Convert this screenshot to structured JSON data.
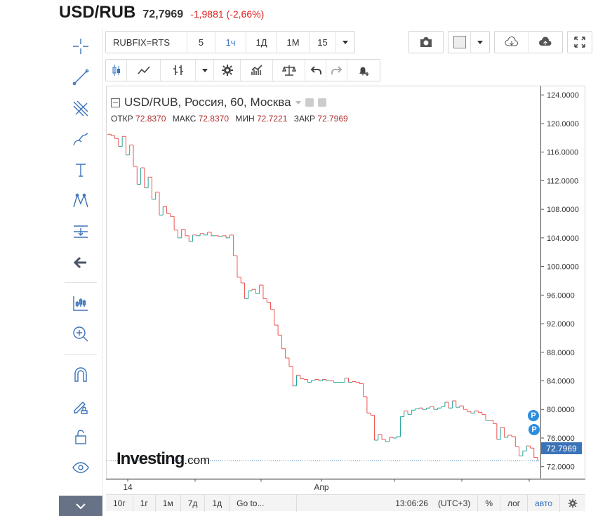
{
  "header": {
    "symbol": "USD/RUB",
    "price": "72,7969",
    "change": "-1,9881 (-2,66%)"
  },
  "toolbar": {
    "symbol_input": "RUBFIX=RTS",
    "intervals": [
      "5",
      "1ч",
      "1Д",
      "1М",
      "15"
    ],
    "active_interval": "1ч"
  },
  "legend": {
    "title": "USD/RUB, Россия, 60, Москва",
    "open_label": "ОТКР",
    "open": "72.8370",
    "high_label": "МАКС",
    "high": "72.8370",
    "low_label": "МИН",
    "low": "72.7221",
    "close_label": "ЗАКР",
    "close": "72.7969"
  },
  "logo": {
    "brand": "Investing",
    "suffix": ".com"
  },
  "last_price": "72.7969",
  "bottom": {
    "ranges": [
      "10г",
      "1г",
      "1м",
      "7д",
      "1д"
    ],
    "goto": "Go to...",
    "time": "13:06:26",
    "tz": "(UTC+3)",
    "percent": "%",
    "log": "лог",
    "auto": "авто"
  },
  "colors": {
    "up": "#26a69a",
    "down": "#ef5350",
    "accent": "#3b73b9",
    "change": "#e0201b"
  },
  "chart_data": {
    "type": "line",
    "xlabel": "",
    "ylabel": "",
    "x_ticks": [
      "14",
      "Апр"
    ],
    "y_ticks": [
      "72.0000",
      "76.0000",
      "80.0000",
      "84.0000",
      "88.0000",
      "92.0000",
      "96.0000",
      "100.0000",
      "104.0000",
      "108.0000",
      "112.0000",
      "116.0000",
      "120.0000",
      "124.0000"
    ],
    "ylim": [
      70.4,
      125.2
    ],
    "series": [
      {
        "values": [
          118.5,
          118.3,
          117.9,
          116.8,
          118.2,
          115.6,
          117.0,
          114.0,
          111.5,
          113.8,
          111.0,
          112.5,
          109.4,
          110.4,
          107.2,
          108.4,
          107.4,
          107.0,
          105.1,
          104.0,
          105.2,
          104.3,
          103.5,
          104.4,
          104.3,
          104.6,
          104.4,
          104.8,
          104.3,
          104.3,
          104.2,
          104.3,
          104.0,
          104.4,
          101.5,
          98.5,
          97.7,
          95.5,
          96.6,
          96.8,
          96.2,
          97.4,
          95.5,
          95.0,
          94.0,
          91.8,
          90.4,
          88.5,
          87.2,
          86.0,
          83.3,
          84.8,
          84.3,
          84.2,
          83.8,
          84.1,
          84.2,
          84.0,
          84.2,
          84.0,
          84.0,
          83.8,
          83.8,
          83.8,
          84.4,
          83.8,
          83.9,
          83.8,
          83.6,
          81.8,
          79.5,
          79.2,
          75.7,
          76.5,
          75.8,
          75.5,
          76.1,
          76.0,
          76.2,
          79.0,
          79.8,
          79.3,
          79.9,
          80.1,
          80.2,
          80.0,
          80.2,
          80.4,
          80.0,
          80.2,
          80.4,
          81.0,
          80.2,
          81.2,
          80.3,
          80.5,
          80.0,
          79.7,
          79.5,
          79.8,
          79.6,
          79.3,
          78.5,
          78.5,
          78.0,
          75.8,
          77.5,
          76.1,
          76.4,
          76.2,
          74.8,
          73.5,
          74.2,
          74.9,
          74.6,
          73.3,
          72.8
        ]
      }
    ]
  }
}
